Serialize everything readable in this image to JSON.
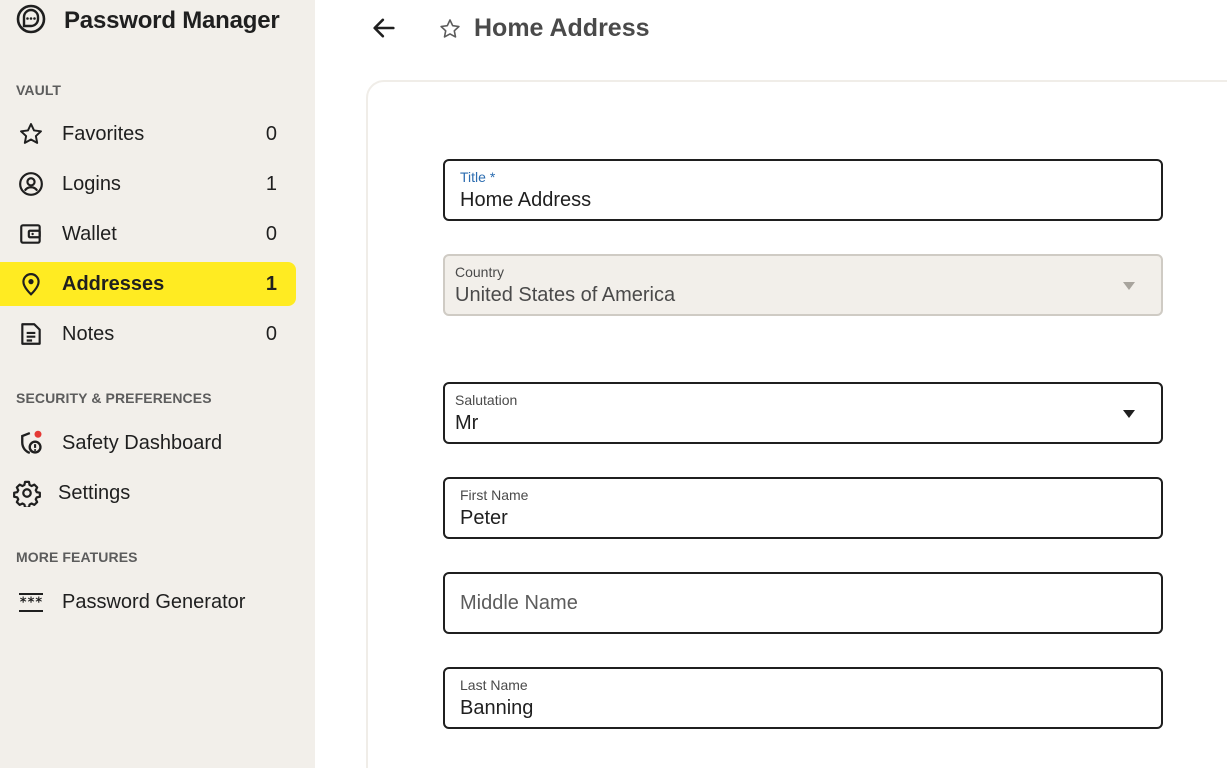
{
  "app": {
    "title": "Password Manager"
  },
  "sidebar": {
    "sections": {
      "vault": "VAULT",
      "security": "SECURITY & PREFERENCES",
      "more": "MORE FEATURES"
    },
    "items": [
      {
        "label": "Favorites",
        "count": "0",
        "icon": "star-icon"
      },
      {
        "label": "Logins",
        "count": "1",
        "icon": "user-circle-icon"
      },
      {
        "label": "Wallet",
        "count": "0",
        "icon": "wallet-icon"
      },
      {
        "label": "Addresses",
        "count": "1",
        "icon": "location-pin-icon",
        "active": true
      },
      {
        "label": "Notes",
        "count": "0",
        "icon": "note-icon"
      },
      {
        "label": "Safety Dashboard",
        "icon": "shield-alert-icon"
      },
      {
        "label": "Settings",
        "icon": "gear-icon"
      },
      {
        "label": "Password Generator",
        "icon": "password-dots-icon"
      }
    ]
  },
  "header": {
    "title": "Home Address"
  },
  "form": {
    "title": {
      "label": "Title *",
      "value": "Home Address"
    },
    "country": {
      "label": "Country",
      "value": "United States of America"
    },
    "salutation": {
      "label": "Salutation",
      "value": "Mr"
    },
    "first_name": {
      "label": "First Name",
      "value": "Peter"
    },
    "middle_name": {
      "placeholder": "Middle Name"
    },
    "last_name": {
      "label": "Last Name",
      "value": "Banning"
    }
  },
  "colors": {
    "accent": "#ffeb22",
    "sidebar_bg": "#f2efea",
    "alert_dot": "#e53935",
    "required_label": "#2b6cb0"
  }
}
